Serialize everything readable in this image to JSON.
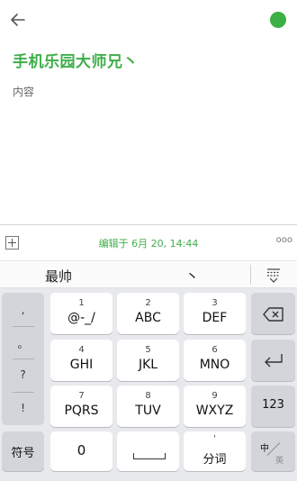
{
  "note": {
    "title": "手机乐园大师兄丶",
    "body": "内容"
  },
  "toolbar": {
    "edit_info": "编辑于 6月 20, 14:44",
    "more": "ooo"
  },
  "candidates": {
    "items": [
      "最帅",
      "丶"
    ]
  },
  "keyboard": {
    "punctuation": [
      ",",
      "。",
      "?",
      "!"
    ],
    "keys": [
      {
        "num": "1",
        "letters": "@-_/"
      },
      {
        "num": "2",
        "letters": "ABC"
      },
      {
        "num": "3",
        "letters": "DEF"
      },
      {
        "num": "4",
        "letters": "GHI"
      },
      {
        "num": "5",
        "letters": "JKL"
      },
      {
        "num": "6",
        "letters": "MNO"
      },
      {
        "num": "7",
        "letters": "PQRS"
      },
      {
        "num": "8",
        "letters": "TUV"
      },
      {
        "num": "9",
        "letters": "WXYZ"
      }
    ],
    "symbols_label": "符号",
    "zero_label": "0",
    "segment_top": "'",
    "segment_label": "分词",
    "numbers_label": "123",
    "lang_zh": "中",
    "lang_en": "英"
  },
  "colors": {
    "accent": "#3fae4a",
    "status_dot": "#3cb044"
  }
}
